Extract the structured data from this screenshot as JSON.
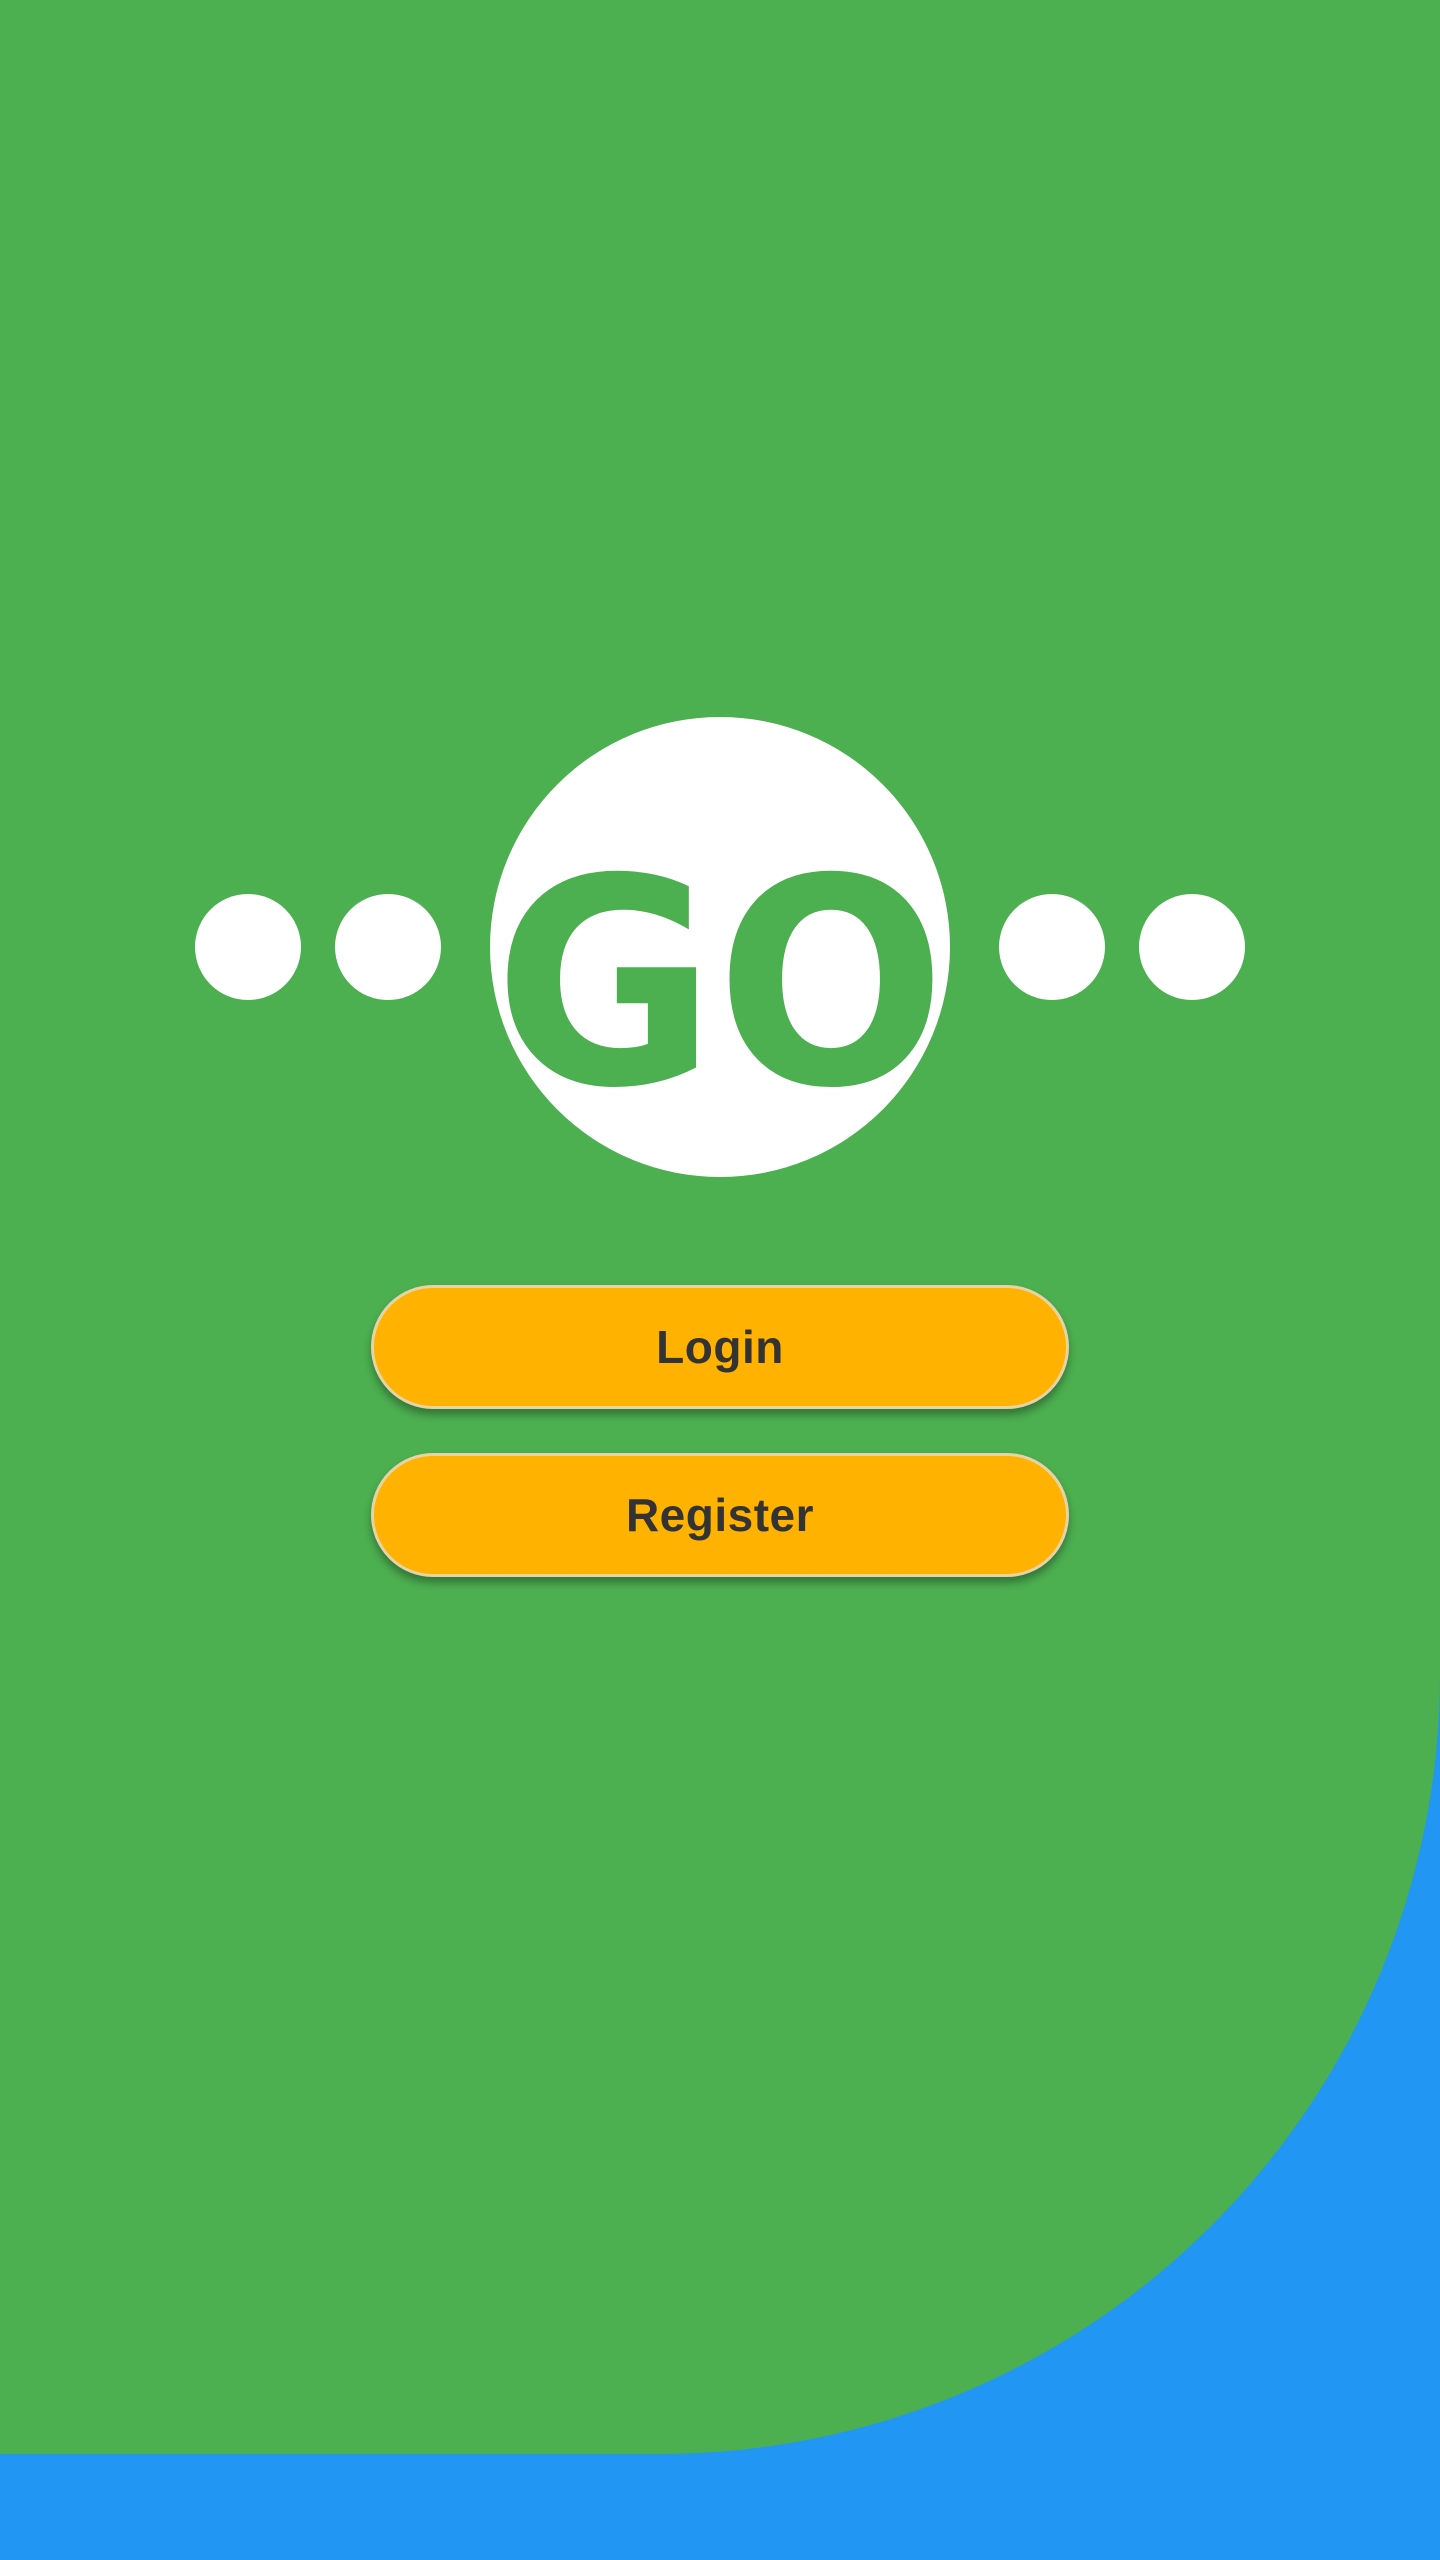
{
  "logo": {
    "text": "GO",
    "icon": "go-logo-icon"
  },
  "actions": {
    "login_label": "Login",
    "register_label": "Register"
  },
  "colors": {
    "primary_green": "#4CAF50",
    "accent_blue": "#2196F3",
    "button_amber": "#FFB300",
    "button_text": "#333333",
    "logo_white": "#FFFFFF"
  }
}
